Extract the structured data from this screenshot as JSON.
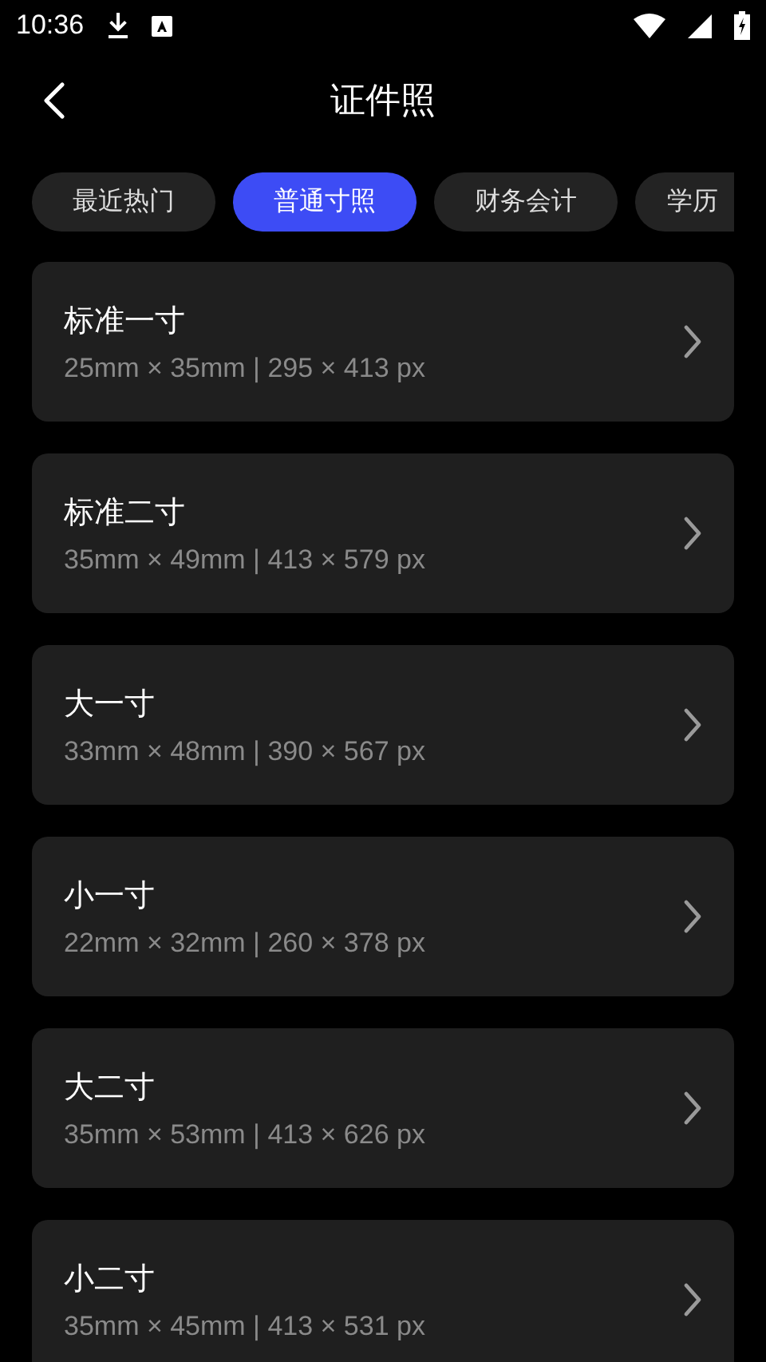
{
  "status_bar": {
    "time": "10:36"
  },
  "header": {
    "title": "证件照"
  },
  "tabs": [
    {
      "label": "最近热门",
      "selected": false
    },
    {
      "label": "普通寸照",
      "selected": true
    },
    {
      "label": "财务会计",
      "selected": false
    },
    {
      "label": "学历",
      "selected": false
    }
  ],
  "sizes": [
    {
      "name": "标准一寸",
      "spec": "25mm × 35mm | 295 × 413 px"
    },
    {
      "name": "标准二寸",
      "spec": "35mm × 49mm | 413 × 579 px"
    },
    {
      "name": "大一寸",
      "spec": "33mm × 48mm | 390 × 567 px"
    },
    {
      "name": "小一寸",
      "spec": "22mm × 32mm | 260 × 378 px"
    },
    {
      "name": "大二寸",
      "spec": "35mm × 53mm | 413 × 626 px"
    },
    {
      "name": "小二寸",
      "spec": "35mm × 45mm | 413 × 531 px"
    }
  ]
}
